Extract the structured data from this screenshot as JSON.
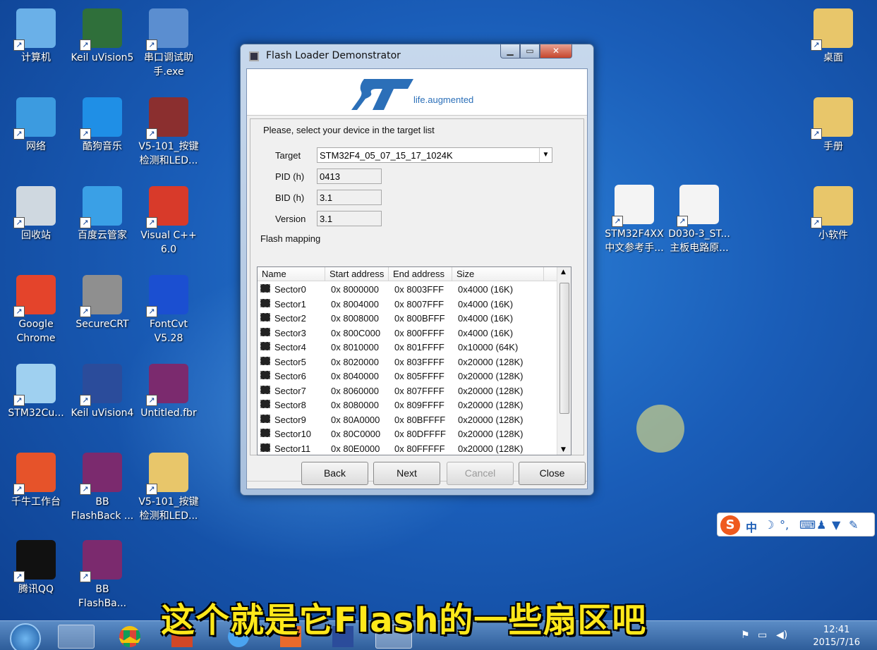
{
  "desktop": {
    "icons": [
      {
        "label": "计算机",
        "icon": "computer-icon"
      },
      {
        "label": "Keil uVision5",
        "icon": "keil-icon"
      },
      {
        "label": "串口调试助\n手.exe",
        "icon": "serial-tool-icon"
      },
      {
        "label": "网络",
        "icon": "network-icon"
      },
      {
        "label": "酷狗音乐",
        "icon": "kugou-icon"
      },
      {
        "label": "V5-101_按键\n检测和LED...",
        "icon": "winrar-icon"
      },
      {
        "label": "回收站",
        "icon": "recycle-bin-icon"
      },
      {
        "label": "百度云管家",
        "icon": "baidu-cloud-icon"
      },
      {
        "label": "Visual C++\n6.0",
        "icon": "visual-cpp-icon"
      },
      {
        "label": "Google\nChrome",
        "icon": "chrome-icon"
      },
      {
        "label": "SecureCRT",
        "icon": "securecrt-icon"
      },
      {
        "label": "FontCvt\nV5.28",
        "icon": "fontcvt-icon"
      },
      {
        "label": "STM32Cu...",
        "icon": "stm32cube-icon"
      },
      {
        "label": "Keil uVision4",
        "icon": "keil4-icon"
      },
      {
        "label": "Untitled.fbr",
        "icon": "flashback-file-icon"
      },
      {
        "label": "千牛工作台",
        "icon": "qianniu-icon"
      },
      {
        "label": "BB\nFlashBack ...",
        "icon": "flashback-icon"
      },
      {
        "label": "V5-101_按键\n检测和LED...",
        "icon": "folder-icon"
      },
      {
        "label": "腾讯QQ",
        "icon": "qq-icon"
      },
      {
        "label": "BB\nFlashBa...",
        "icon": "flashback2-icon"
      },
      {
        "label": "桌面",
        "icon": "folder-icon"
      },
      {
        "label": "手册",
        "icon": "folder-icon"
      },
      {
        "label": "小软件",
        "icon": "folder-icon"
      },
      {
        "label": "STM32F4XX\n中文参考手...",
        "icon": "pdf-doc-icon"
      },
      {
        "label": "D030-3_ST...\n主板电路原...",
        "icon": "pdf-doc-icon"
      }
    ]
  },
  "window": {
    "title": "Flash Loader Demonstrator",
    "logo_tagline": "life.augmented",
    "instruction": "Please, select your device in the target list",
    "target_label": "Target",
    "target_value": "STM32F4_05_07_15_17_1024K",
    "pid_label": "PID  (h)",
    "pid_value": "0413",
    "bid_label": "BID  (h)",
    "bid_value": "3.1",
    "version_label": "Version",
    "version_value": "3.1",
    "mapping_label": "Flash mapping",
    "columns": [
      "Name",
      "Start address",
      "End address",
      "Size"
    ],
    "rows": [
      [
        "Sector0",
        "0x 8000000",
        "0x 8003FFF",
        "0x4000 (16K)"
      ],
      [
        "Sector1",
        "0x 8004000",
        "0x 8007FFF",
        "0x4000 (16K)"
      ],
      [
        "Sector2",
        "0x 8008000",
        "0x 800BFFF",
        "0x4000 (16K)"
      ],
      [
        "Sector3",
        "0x 800C000",
        "0x 800FFFF",
        "0x4000 (16K)"
      ],
      [
        "Sector4",
        "0x 8010000",
        "0x 801FFFF",
        "0x10000 (64K)"
      ],
      [
        "Sector5",
        "0x 8020000",
        "0x 803FFFF",
        "0x20000 (128K)"
      ],
      [
        "Sector6",
        "0x 8040000",
        "0x 805FFFF",
        "0x20000 (128K)"
      ],
      [
        "Sector7",
        "0x 8060000",
        "0x 807FFFF",
        "0x20000 (128K)"
      ],
      [
        "Sector8",
        "0x 8080000",
        "0x 809FFFF",
        "0x20000 (128K)"
      ],
      [
        "Sector9",
        "0x 80A0000",
        "0x 80BFFFF",
        "0x20000 (128K)"
      ],
      [
        "Sector10",
        "0x 80C0000",
        "0x 80DFFFF",
        "0x20000 (128K)"
      ],
      [
        "Sector11",
        "0x 80E0000",
        "0x 80FFFFF",
        "0x20000 (128K)"
      ]
    ],
    "buttons": {
      "back": "Back",
      "next": "Next",
      "cancel": "Cancel",
      "close": "Close"
    }
  },
  "caption": "这个就是它Flash的一些扇区吧",
  "ime": {
    "logo": "S",
    "mode": "中"
  },
  "taskbar": {
    "time": "12:41",
    "date": "2015/7/16"
  },
  "colors": {
    "desktop": "#1a5db8",
    "caption": "#ffe81a",
    "st_blue": "#2b6fb8"
  }
}
